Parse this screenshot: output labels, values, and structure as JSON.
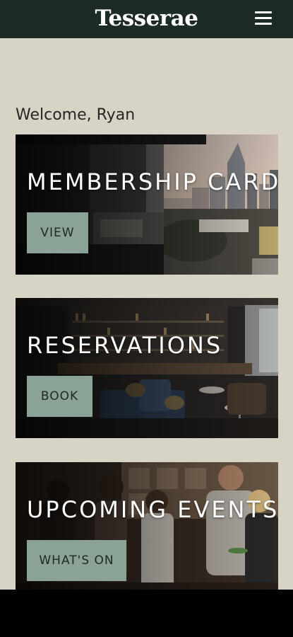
{
  "header": {
    "logo": "Tesserae",
    "menu_icon": "hamburger-menu-icon"
  },
  "welcome": "Welcome, Ryan",
  "cards": [
    {
      "title": "MEMBERSHIP CARD",
      "button": "VIEW"
    },
    {
      "title": "RESERVATIONS",
      "button": "BOOK"
    },
    {
      "title": "UPCOMING EVENTS",
      "button": "WHAT'S ON"
    }
  ],
  "colors": {
    "header_bg": "#1c2b25",
    "page_bg": "#d7d4c6",
    "button_bg": "#8aa396"
  }
}
